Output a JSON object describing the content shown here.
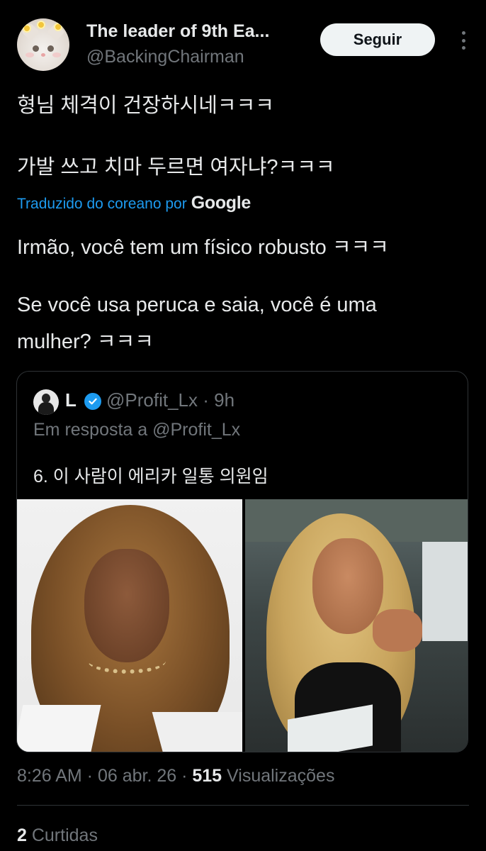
{
  "author": {
    "name": "The leader of 9th Ea...",
    "handle": "@BackingChairman",
    "avatar_icon": "cat-with-flower-crown-avatar"
  },
  "actions": {
    "follow_label": "Seguir",
    "more_icon": "vertical-ellipsis-icon"
  },
  "tweet": {
    "original_line1": "형님 체격이 건장하시네ㅋㅋㅋ",
    "original_line2": "가발 쓰고 치마 두르면 여자냐?ㅋㅋㅋ",
    "translated_label": "Traduzido do coreano por",
    "translated_brand": "Google",
    "translation_line1": "Irmão, você tem um físico robusto ㅋㅋㅋ",
    "translation_line2": "Se você usa peruca e saia, você é uma",
    "translation_line3": "mulher? ㅋㅋㅋ"
  },
  "quoted": {
    "name": "L",
    "handle_time": "@Profit_Lx · 9h",
    "reply_to": "Em resposta a @Profit_Lx",
    "text": "6. 이 사람이 에리카 일통 의원임",
    "verified_icon": "verified-badge-icon",
    "images": [
      "photo-woman-portrait",
      "photo-woman-seated"
    ]
  },
  "meta": {
    "time_date": "8:26 AM · 06 abr. 26 · ",
    "views_count": "515",
    "views_label": " Visualizações"
  },
  "engagement": {
    "likes_count": "2",
    "likes_label": " Curtidas"
  },
  "colors": {
    "background": "#000000",
    "text": "#e7e9ea",
    "muted": "#71767b",
    "accent": "#1d9bf0",
    "border": "#2f3336"
  }
}
